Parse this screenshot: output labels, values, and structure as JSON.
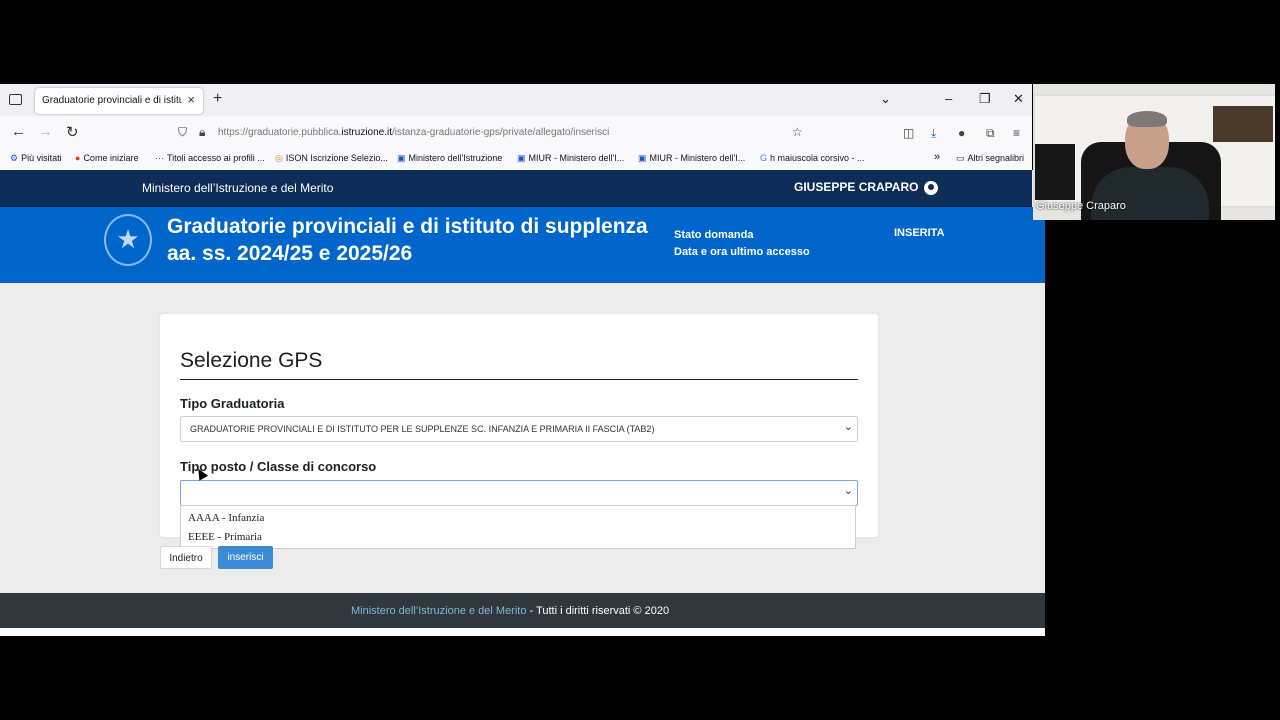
{
  "browser": {
    "tab_title": "Graduatorie provinciali e di istituto",
    "tab_close": "×",
    "new_tab": "+",
    "url_prefix": "https://graduatorie.pubblica.",
    "url_host": "istruzione.it",
    "url_path": "/istanza-graduatorie-gps/private/allegato/inserisci",
    "bookmarks": [
      {
        "label": "Più visitati",
        "icon": "⚙"
      },
      {
        "label": "Come iniziare",
        "icon": "●"
      },
      {
        "label": "Titoli accesso ai profili ...",
        "icon": "⋯"
      },
      {
        "label": "ISON Iscrizione Selezio...",
        "icon": "◎"
      },
      {
        "label": "Ministero dell'Istruzione",
        "icon": "▣"
      },
      {
        "label": "MIUR - Ministero dell'I...",
        "icon": "▣"
      },
      {
        "label": "MIUR - Ministero dell'I...",
        "icon": "▣"
      },
      {
        "label": "h maiuscola corsivo - ...",
        "icon": "G"
      },
      {
        "label": "Altri segnalibri",
        "icon": "▭"
      }
    ]
  },
  "site": {
    "ministry": "Ministero dell’Istruzione e del Merito",
    "user": "GIUSEPPE CRAPARO",
    "title_line1": "Graduatorie provinciali e di istituto di supplenza",
    "title_line2": "aa. ss. 2024/25 e 2025/26",
    "stato_label": "Stato domanda",
    "data_label": "Data e ora ultimo accesso",
    "stato_value": "INSERITA"
  },
  "form": {
    "title": "Selezione GPS",
    "tipo_graduatoria_label": "Tipo Graduatoria",
    "tipo_graduatoria_value": "GRADUATORIE PROVINCIALI E DI ISTITUTO PER LE SUPPLENZE SC. INFANZIA E PRIMARIA II FASCIA (TAB2)",
    "tipo_posto_label": "Tipo posto / Classe di concorso",
    "tipo_posto_value": "",
    "options": [
      "AAAA - Infanzia",
      "EEEE - Primaria"
    ],
    "back_label": "Indietro",
    "insert_label": "inserisci"
  },
  "footer": {
    "link": "Ministero dell’Istruzione e del Merito",
    "rights": " - Tutti i diritti riservati © 2020"
  },
  "video": {
    "participant": "Giuseppe Craparo"
  }
}
